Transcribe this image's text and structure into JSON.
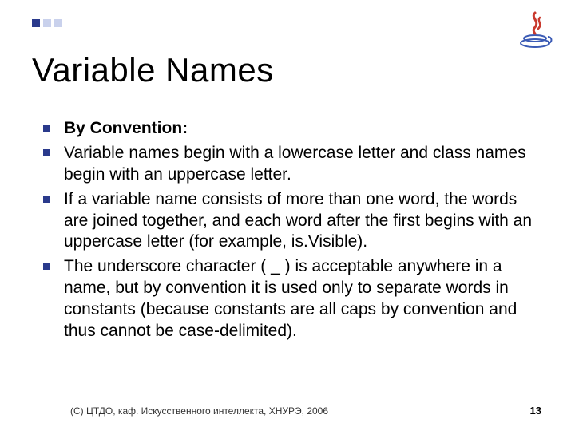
{
  "title": "Variable Names",
  "bullets": [
    {
      "text": "By Convention:",
      "bold": true
    },
    {
      "text": "Variable names begin with a lowercase letter and class names begin with an uppercase letter."
    },
    {
      "text": "If a variable name consists of more than one word, the words are joined together, and each word after the first begins with an uppercase letter (for example, is.Visible)."
    },
    {
      "text": "The underscore character ( _ ) is acceptable anywhere in a name, but by convention it is used only to separate words in constants (because constants are all caps by convention and thus cannot be case-delimited)."
    }
  ],
  "footer": "(С) ЦТДО, каф. Искусственного интеллекта, ХНУРЭ, 2006",
  "page_number": "13",
  "logo_name": "java-duke-icon"
}
